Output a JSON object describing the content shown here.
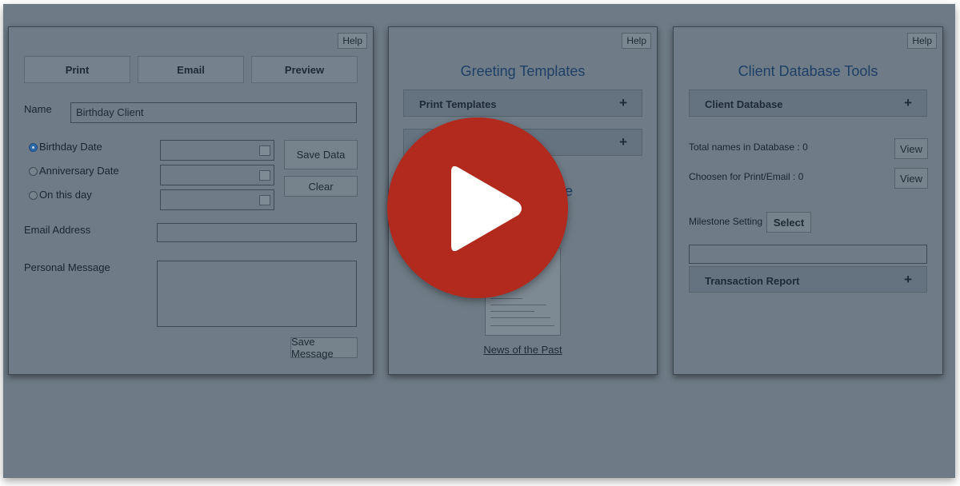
{
  "panel_left": {
    "help_label": "Help",
    "buttons": {
      "print": "Print",
      "email": "Email",
      "preview": "Preview"
    },
    "name_label": "Name",
    "name_value": "Birthday Client",
    "date_options": [
      {
        "label": "Birthday Date",
        "checked": true
      },
      {
        "label": "Anniversary Date",
        "checked": false
      },
      {
        "label": "On this day",
        "checked": false
      }
    ],
    "save_data_label": "Save Data",
    "clear_label": "Clear",
    "email_label": "Email Address",
    "message_label": "Personal Message",
    "save_message_label": "Save Message"
  },
  "panel_middle": {
    "help_label": "Help",
    "title": "Greeting Templates",
    "accordion_print": "Print Templates",
    "accordion_second": "",
    "partial_heading": "e",
    "link_label": "News of the Past"
  },
  "panel_right": {
    "help_label": "Help",
    "title": "Client Database Tools",
    "accordion_db": "Client Database",
    "total_names": "Total names in Database : 0",
    "chosen": "Choosen for Print/Email : 0",
    "view_label": "View",
    "milestone_label": "Milestone Setting",
    "select_label": "Select",
    "accordion_report": "Transaction Report"
  },
  "icons": {
    "plus": "+",
    "play": "play-icon",
    "calendar": "calendar-icon"
  },
  "colors": {
    "overlay": "#6e7b86",
    "play": "#b22a1e",
    "title": "#1e3f66"
  }
}
